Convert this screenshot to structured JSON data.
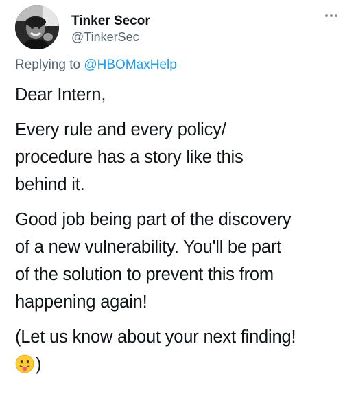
{
  "tweet": {
    "display_name": "Tinker Secor",
    "handle": "@TinkerSec",
    "more_icon": "ellipsis-icon",
    "reply": {
      "prefix": "Replying to",
      "mention": "@HBOMaxHelp"
    },
    "paragraphs": [
      [
        "Dear Intern,"
      ],
      [
        "Every rule and every policy/",
        "procedure has a story like this",
        "behind it."
      ],
      [
        "Good job being part of the discovery",
        "of a new vulnerability. You'll be part",
        "of the solution to prevent this from",
        "happening again!"
      ],
      [
        "(Let us know about your next finding!"
      ]
    ],
    "last_line_suffix": ")",
    "emoji": "face-with-tongue-emoji",
    "colors": {
      "text": "#0f1419",
      "secondary": "#536471",
      "accent": "#1d9bf0"
    }
  }
}
